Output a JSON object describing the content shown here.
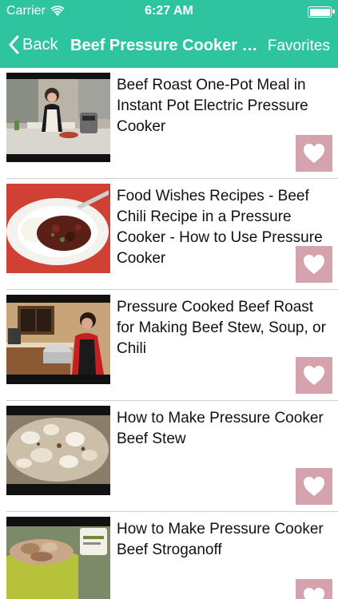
{
  "status_bar": {
    "carrier": "Carrier",
    "time": "6:27 AM"
  },
  "nav": {
    "back_label": "Back",
    "title": "Beef Pressure Cooker Recipes",
    "favorites_label": "Favorites"
  },
  "colors": {
    "header": "#2ec4a0",
    "favorite_button": "#d4a3ad"
  },
  "icons": {
    "back": "chevron-left-icon",
    "favorite": "heart-icon",
    "wifi": "wifi-icon",
    "battery": "battery-icon"
  },
  "videos": [
    {
      "title": "Beef Roast One-Pot Meal in Instant Pot Electric Pressure Cooker"
    },
    {
      "title": "Food Wishes Recipes - Beef Chili Recipe in a Pressure Cooker - How to Use Pressure Cooker"
    },
    {
      "title": "Pressure Cooked Beef Roast for Making Beef Stew, Soup, or Chili"
    },
    {
      "title": "How to Make Pressure Cooker Beef Stew"
    },
    {
      "title": "How to Make Pressure Cooker Beef Stroganoff"
    }
  ]
}
